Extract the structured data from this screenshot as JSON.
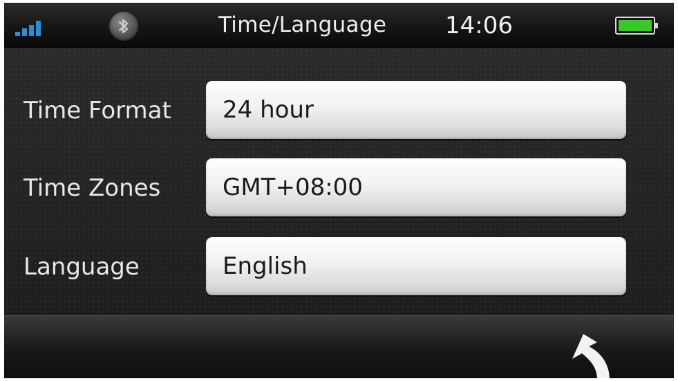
{
  "status_bar": {
    "title": "Time/Language",
    "clock": "14:06",
    "signal_icon": "signal-bars-icon",
    "bluetooth_icon": "bluetooth-icon",
    "battery_icon": "battery-icon",
    "signal_color": "#2a8fd8",
    "battery_color": "#3cc82a"
  },
  "settings": [
    {
      "label": "Time Format",
      "value": "24 hour"
    },
    {
      "label": "Time Zones",
      "value": "GMT+08:00"
    },
    {
      "label": "Language",
      "value": "English"
    }
  ],
  "bottom_bar": {
    "back_icon": "back-arrow-icon"
  }
}
